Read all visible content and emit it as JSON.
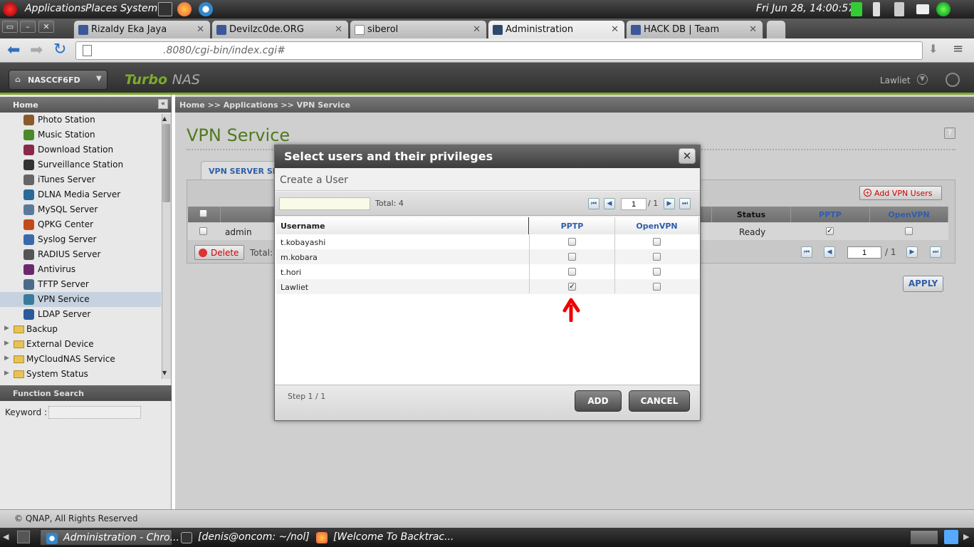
{
  "gnome_panel": {
    "menus": [
      "Applications",
      "Places",
      "System"
    ],
    "clock": "Fri Jun 28, 14:00:57"
  },
  "browser": {
    "tabs": [
      {
        "label": "Rizaldy Eka Jaya",
        "favicon_color": "#3b5998"
      },
      {
        "label": "Devilzc0de.ORG",
        "favicon_color": "#3b5998"
      },
      {
        "label": "siberol",
        "favicon_color": "#eeeeee"
      },
      {
        "label": "Administration",
        "favicon_color": "#2b4a6b",
        "active": true
      },
      {
        "label": "HACK DB | Team",
        "favicon_color": "#3b5998"
      }
    ],
    "url": ".8080/cgi-bin/index.cgi#"
  },
  "nas": {
    "device_name": "NASCCF6FD",
    "brand_turbo": "Turbo",
    "brand_nas": "NAS",
    "user": "Lawliet",
    "accent": "#7dab2a"
  },
  "sidebar": {
    "home_label": "Home",
    "items": [
      {
        "label": "Photo Station",
        "color": "#8a5a2a"
      },
      {
        "label": "Music Station",
        "color": "#4a8a2a"
      },
      {
        "label": "Download Station",
        "color": "#8a2a4a"
      },
      {
        "label": "Surveillance Station",
        "color": "#333333"
      },
      {
        "label": "iTunes Server",
        "color": "#666666"
      },
      {
        "label": "DLNA Media Server",
        "color": "#2a6a9a"
      },
      {
        "label": "MySQL Server",
        "color": "#5a7a9a"
      },
      {
        "label": "QPKG Center",
        "color": "#c24a1a"
      },
      {
        "label": "Syslog Server",
        "color": "#3a6aaa"
      },
      {
        "label": "RADIUS Server",
        "color": "#555555"
      },
      {
        "label": "Antivirus",
        "color": "#6a2a6a"
      },
      {
        "label": "TFTP Server",
        "color": "#4a6a8a"
      },
      {
        "label": "VPN Service",
        "color": "#3a7a9a",
        "selected": true
      },
      {
        "label": "LDAP Server",
        "color": "#2a5a9a"
      }
    ],
    "folders": [
      "Backup",
      "External Device",
      "MyCloudNAS Service",
      "System Status"
    ],
    "function_search": "Function Search",
    "keyword_label": "Keyword :"
  },
  "main": {
    "breadcrumb": "Home >> Applications >> VPN Service",
    "title": "VPN Service",
    "tab_label": "VPN SERVER SE",
    "add_vpn_users": "Add VPN Users",
    "table_headers": [
      "Status",
      "PPTP",
      "OpenVPN"
    ],
    "row_user": "admin",
    "row_status": "Ready",
    "delete_label": "Delete",
    "total_label": "Total:",
    "page_input": "1",
    "page_of": "/ 1",
    "apply_label": "APPLY"
  },
  "dialog": {
    "title": "Select users and their privileges",
    "create_user": "Create a User",
    "total": "Total:  4",
    "page_input": "1",
    "page_of": "/ 1",
    "columns": [
      "Username",
      "PPTP",
      "OpenVPN"
    ],
    "users": [
      {
        "name": "t.kobayashi",
        "pptp": false,
        "openvpn": false
      },
      {
        "name": "m.kobara",
        "pptp": false,
        "openvpn": false
      },
      {
        "name": "t.hori",
        "pptp": false,
        "openvpn": false
      },
      {
        "name": "Lawliet",
        "pptp": true,
        "openvpn": false
      }
    ],
    "step": "Step 1 / 1",
    "add_label": "ADD",
    "cancel_label": "CANCEL"
  },
  "footer": {
    "copyright": "© QNAP, All Rights Reserved"
  },
  "taskbar": {
    "tasks": [
      "Administration - Chro...",
      "[denis@oncom: ~/nol]",
      "[Welcome To Backtrac..."
    ]
  }
}
